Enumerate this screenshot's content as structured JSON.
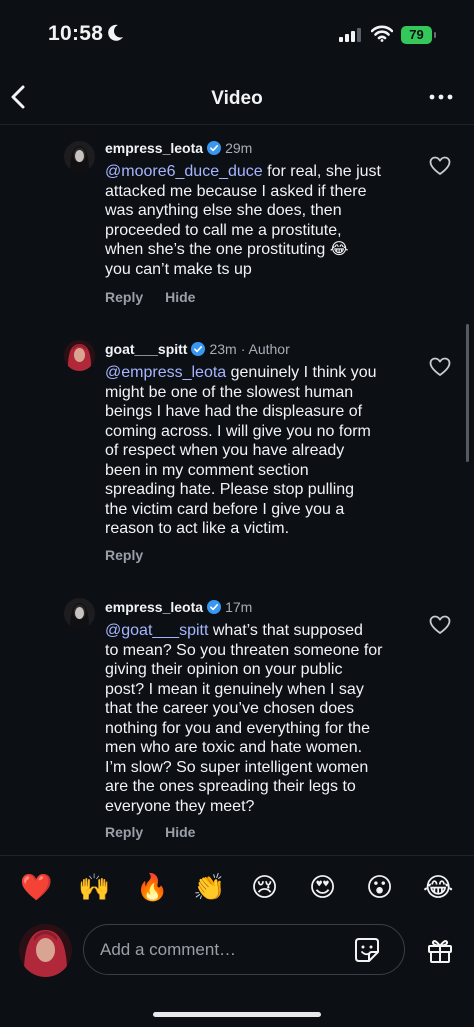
{
  "status_bar": {
    "time": "10:58",
    "battery": "79"
  },
  "nav": {
    "title": "Video"
  },
  "comments": [
    {
      "username": "empress_leota",
      "time": "29m",
      "author_label": "",
      "mention": "@moore6_duce_duce",
      "text_lines": [
        " for real, she just",
        "attacked me because I asked if there",
        "was anything else she does, then",
        "proceeded to call me a prostitute,",
        "when she’s the one prostituting 😂",
        "you can’t make ts up"
      ],
      "reply": "Reply",
      "hide": "Hide"
    },
    {
      "username": "goat___spitt",
      "time": "23m",
      "author_label": "· Author",
      "mention": "@empress_leota",
      "text_lines": [
        " genuinely I think you",
        "might be one of the slowest human",
        "beings I have had the displeasure of",
        "coming across. I will give you no form",
        "of respect when you have already",
        "been in my comment section",
        "spreading hate. Please stop pulling",
        "the victim card before I give you a",
        "reason to act like a victim."
      ],
      "reply": "Reply",
      "hide": ""
    },
    {
      "username": "empress_leota",
      "time": "17m",
      "author_label": "",
      "mention": "@goat___spitt",
      "text_lines": [
        " what’s that supposed",
        "to mean? So you threaten someone for",
        "giving their opinion on your public",
        "post? I mean it genuinely when I say",
        "that the career you’ve chosen does",
        "nothing for you and everything for the",
        "men who are toxic and hate women.",
        "I’m slow? So super intelligent women",
        "are the ones spreading their legs to",
        "everyone they meet?"
      ],
      "reply": "Reply",
      "hide": "Hide"
    }
  ],
  "emoji_bar": [
    "❤️",
    "🙌",
    "🔥",
    "👏",
    "😢",
    "😍",
    "😮",
    "😂"
  ],
  "composer": {
    "placeholder": "Add a comment…"
  },
  "colors": {
    "background": "#0c0f14",
    "mention": "#a6b5ff",
    "verified": "#3897f0",
    "battery": "#34c759"
  }
}
